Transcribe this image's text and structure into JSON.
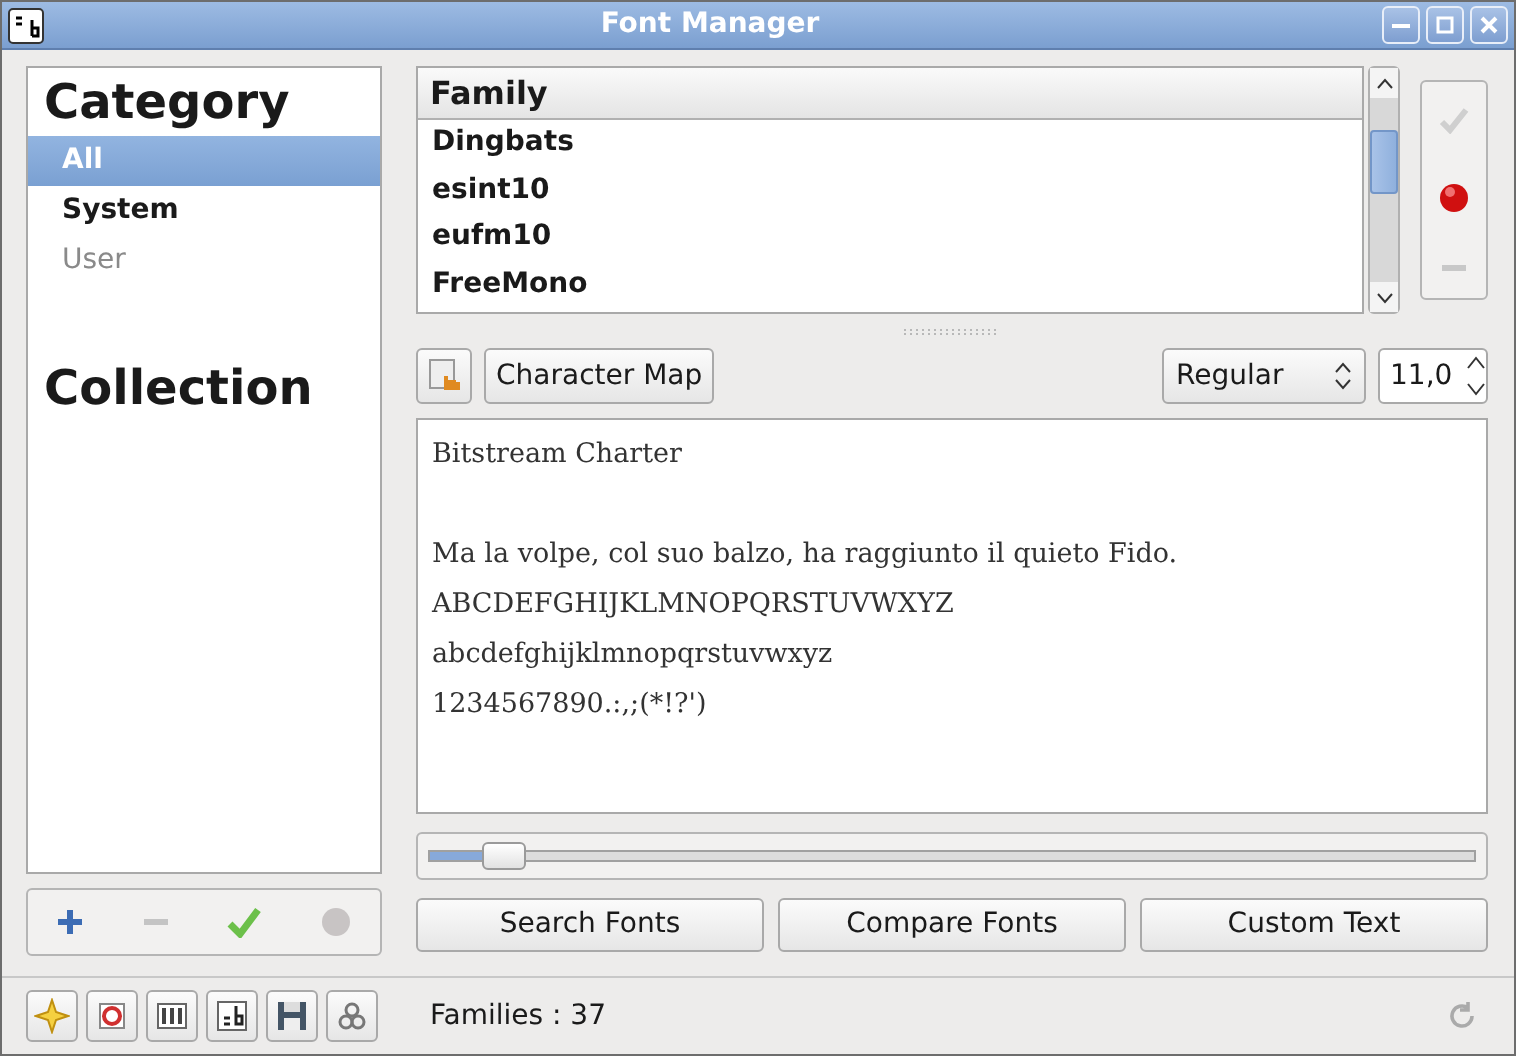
{
  "window": {
    "title": "Font Manager"
  },
  "sidebar": {
    "category_heading": "Category",
    "categories": [
      {
        "label": "All",
        "selected": true,
        "dimmed": false
      },
      {
        "label": "System",
        "selected": false,
        "dimmed": false
      },
      {
        "label": "User",
        "selected": false,
        "dimmed": true
      }
    ],
    "collection_heading": "Collection"
  },
  "family_list": {
    "column": "Family",
    "rows": [
      {
        "name": "Dingbats",
        "selected": false
      },
      {
        "name": "esint10",
        "selected": false
      },
      {
        "name": "eufm10",
        "selected": false
      },
      {
        "name": "FreeMono",
        "selected": false
      }
    ]
  },
  "toolbar": {
    "character_map": "Character Map",
    "style": "Regular",
    "size": "11,0"
  },
  "preview": {
    "font_name": "Bitstream Charter",
    "lines": [
      "Ma la volpe, col suo balzo, ha raggiunto il quieto Fido.",
      "ABCDEFGHIJKLMNOPQRSTUVWXYZ",
      "abcdefghijklmnopqrstuvwxyz",
      "1234567890.:,;(*!?')"
    ]
  },
  "size_slider": {
    "level": 0.07
  },
  "buttons": [
    "Search Fonts",
    "Compare Fonts",
    "Custom Text"
  ],
  "status_bar": {
    "text": "Families : 37"
  }
}
